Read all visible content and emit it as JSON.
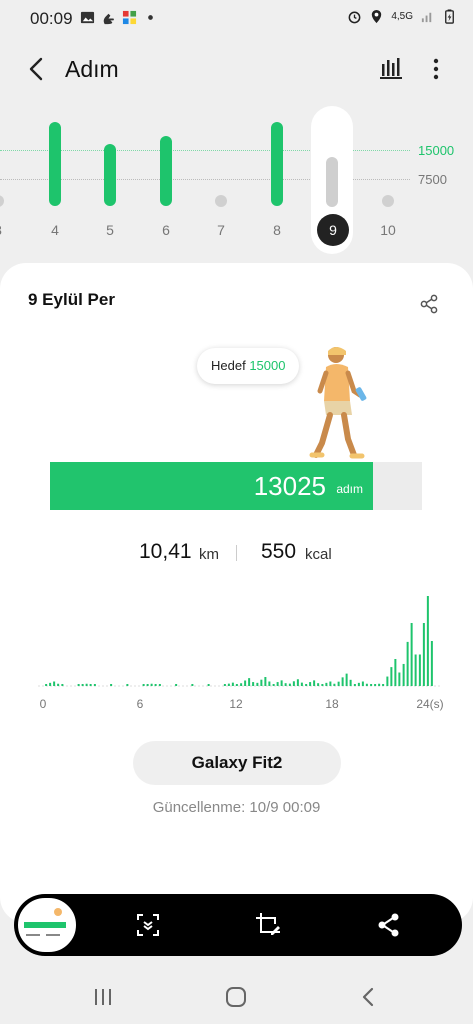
{
  "status_bar": {
    "time": "00:09",
    "network": "4,5G"
  },
  "app_bar": {
    "title": "Adım"
  },
  "week_chart": {
    "days": [
      {
        "label": "3",
        "steps": 0
      },
      {
        "label": "4",
        "steps": 15000
      },
      {
        "label": "5",
        "steps": 11000
      },
      {
        "label": "6",
        "steps": 12500
      },
      {
        "label": "7",
        "steps": 0
      },
      {
        "label": "8",
        "steps": 15000
      },
      {
        "label": "9",
        "steps": 13025,
        "selected": true
      },
      {
        "label": "10",
        "steps": 0
      }
    ],
    "goal_label": "15000",
    "mid_label": "7500"
  },
  "card": {
    "date": "9 Eylül Per",
    "goal_text": "Hedef",
    "goal_value": "15000",
    "steps": "13025",
    "steps_unit": "adım",
    "progress": 0.868,
    "distance_value": "10,41",
    "distance_unit": "km",
    "calories_value": "550",
    "calories_unit": "kcal",
    "hour_axis": [
      "0",
      "6",
      "12",
      "18",
      "24(s)"
    ],
    "device": "Galaxy Fit2",
    "updated": "Güncellenme: 10/9 00:09"
  },
  "chart_data": {
    "type": "bar",
    "x": [
      0,
      1,
      2,
      3,
      4,
      5,
      6,
      7,
      8,
      9,
      10,
      11,
      12,
      13,
      14,
      15,
      16,
      17,
      18,
      19,
      20,
      21,
      22,
      23
    ],
    "series": [
      {
        "values": [
          20,
          0,
          10,
          0,
          0,
          0,
          10,
          0,
          0,
          0,
          0,
          15,
          35,
          40,
          25,
          30,
          25,
          20,
          55,
          20,
          10,
          120,
          280,
          400
        ]
      }
    ],
    "xlabel": "",
    "ylabel": "",
    "type_note": "hourly step bars"
  },
  "colors": {
    "accent": "#1ec46c",
    "goal_text": "#1ec46c"
  }
}
